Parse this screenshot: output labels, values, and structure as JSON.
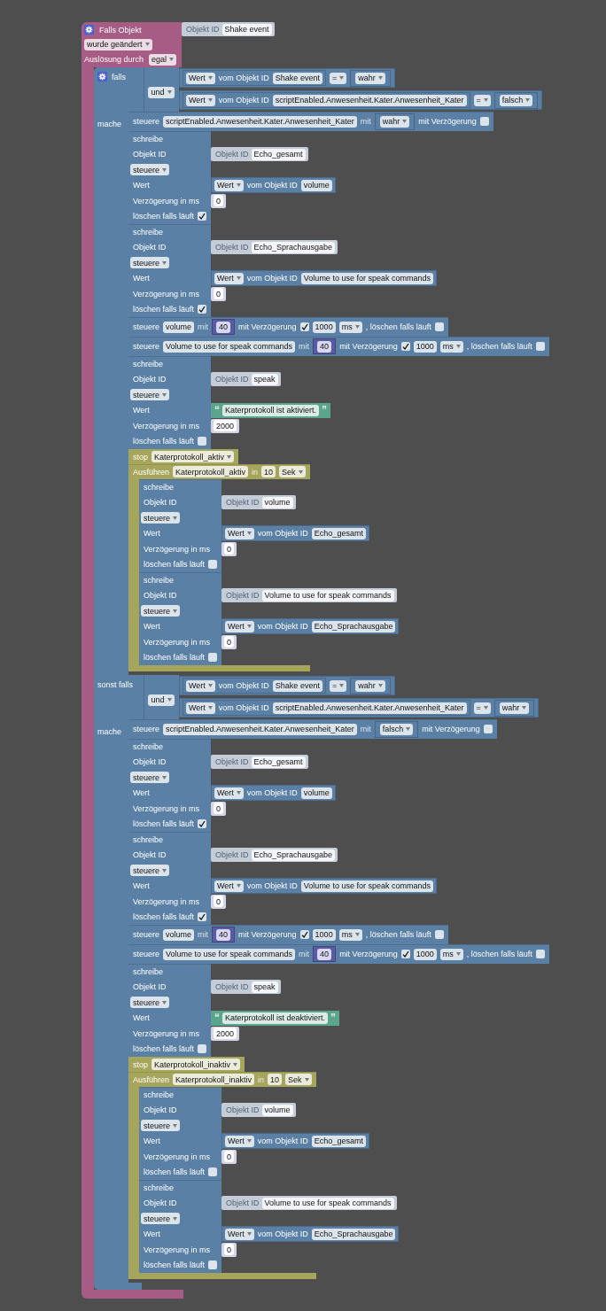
{
  "trigger": {
    "title": "Falls Objekt",
    "object": {
      "label": "Objekt ID",
      "id": "Shake event"
    },
    "event": "wurde geändert",
    "source_label": "Auslösung durch",
    "source": "egal"
  },
  "if_block": {
    "branches": [
      {
        "label": "falls",
        "operator": "und",
        "conditions": [
          {
            "mode": "Wert",
            "from_label": "vom Objekt ID",
            "id": "Shake event",
            "comparator": "=",
            "operand": "wahr"
          },
          {
            "mode": "Wert",
            "from_label": "vom Objekt ID",
            "id": "scriptEnabled.Anwesenheit.Kater.Anwesenheit_Kater",
            "comparator": "=",
            "operand": "falsch"
          }
        ],
        "do_label": "mache",
        "statements": [
          {
            "kind": "control",
            "label": "steuere",
            "id": "scriptEnabled.Anwesenheit.Kater.Anwesenheit_Kater",
            "with_label": "mit",
            "value": {
              "kind": "boolean",
              "text": "wahr"
            },
            "delay_label": "mit Verzögerung",
            "delay": false
          },
          {
            "kind": "write",
            "title": "schreibe",
            "id_label": "Objekt ID",
            "object": {
              "label": "Objekt ID",
              "id": "Echo_gesamt"
            },
            "action": "steuere",
            "value_label": "Wert",
            "value": {
              "kind": "get",
              "mode": "Wert",
              "from_label": "vom Objekt ID",
              "id": "volume"
            },
            "delay_label": "Verzögerung in ms",
            "delay_ms": "0",
            "clear_label": "löschen falls läuft",
            "clear": true
          },
          {
            "kind": "write",
            "title": "schreibe",
            "id_label": "Objekt ID",
            "object": {
              "label": "Objekt ID",
              "id": "Echo_Sprachausgabe"
            },
            "action": "steuere",
            "value_label": "Wert",
            "value": {
              "kind": "get",
              "mode": "Wert",
              "from_label": "vom Objekt ID",
              "id": "Volume to use for speak commands"
            },
            "delay_label": "Verzögerung in ms",
            "delay_ms": "0",
            "clear_label": "löschen falls läuft",
            "clear": true
          },
          {
            "kind": "control",
            "label": "steuere",
            "id": "volume",
            "with_label": "mit",
            "value": {
              "kind": "number",
              "text": "40"
            },
            "delay_label": "mit Verzögerung",
            "delay": true,
            "delay_ms": "1000",
            "unit": "ms",
            "clear_label": ", löschen falls läuft",
            "clear": false
          },
          {
            "kind": "control",
            "label": "steuere",
            "id": "Volume to use for speak commands",
            "with_label": "mit",
            "value": {
              "kind": "number",
              "text": "40"
            },
            "delay_label": "mit Verzögerung",
            "delay": true,
            "delay_ms": "1000",
            "unit": "ms",
            "clear_label": ", löschen falls läuft",
            "clear": false
          },
          {
            "kind": "write",
            "title": "schreibe",
            "id_label": "Objekt ID",
            "object": {
              "label": "Objekt ID",
              "id": "speak"
            },
            "action": "steuere",
            "value_label": "Wert",
            "value": {
              "kind": "text",
              "open": "“",
              "text": "Katerprotokoll ist aktiviert.",
              "close": "”"
            },
            "delay_label": "Verzögerung in ms",
            "delay_ms": "2000",
            "clear_label": "löschen falls läuft",
            "clear": false
          },
          {
            "kind": "stop",
            "label": "stop",
            "timer": "Katerprotokoll_aktiv"
          },
          {
            "kind": "timeout",
            "label": "Ausführen",
            "timer": "Katerprotokoll_aktiv",
            "in_label": "in",
            "interval": "10",
            "unit": "Sek",
            "statements": [
              {
                "kind": "write",
                "title": "schreibe",
                "id_label": "Objekt ID",
                "object": {
                  "label": "Objekt ID",
                  "id": "volume"
                },
                "action": "steuere",
                "value_label": "Wert",
                "value": {
                  "kind": "get",
                  "mode": "Wert",
                  "from_label": "vom Objekt ID",
                  "id": "Echo_gesamt"
                },
                "delay_label": "Verzögerung in ms",
                "delay_ms": "0",
                "clear_label": "löschen falls läuft",
                "clear": false
              },
              {
                "kind": "write",
                "title": "schreibe",
                "id_label": "Objekt ID",
                "object": {
                  "label": "Objekt ID",
                  "id": "Volume to use for speak commands"
                },
                "action": "steuere",
                "value_label": "Wert",
                "value": {
                  "kind": "get",
                  "mode": "Wert",
                  "from_label": "vom Objekt ID",
                  "id": "Echo_Sprachausgabe"
                },
                "delay_label": "Verzögerung in ms",
                "delay_ms": "0",
                "clear_label": "löschen falls läuft",
                "clear": false
              }
            ]
          }
        ]
      },
      {
        "label": "sonst falls",
        "operator": "und",
        "conditions": [
          {
            "mode": "Wert",
            "from_label": "vom Objekt ID",
            "id": "Shake event",
            "comparator": "=",
            "operand": "wahr"
          },
          {
            "mode": "Wert",
            "from_label": "vom Objekt ID",
            "id": "scriptEnabled.Anwesenheit.Kater.Anwesenheit_Kater",
            "comparator": "=",
            "operand": "wahr"
          }
        ],
        "do_label": "mache",
        "statements": [
          {
            "kind": "control",
            "label": "steuere",
            "id": "scriptEnabled.Anwesenheit.Kater.Anwesenheit_Kater",
            "with_label": "mit",
            "value": {
              "kind": "boolean",
              "text": "falsch"
            },
            "delay_label": "mit Verzögerung",
            "delay": false
          },
          {
            "kind": "write",
            "title": "schreibe",
            "id_label": "Objekt ID",
            "object": {
              "label": "Objekt ID",
              "id": "Echo_gesamt"
            },
            "action": "steuere",
            "value_label": "Wert",
            "value": {
              "kind": "get",
              "mode": "Wert",
              "from_label": "vom Objekt ID",
              "id": "volume"
            },
            "delay_label": "Verzögerung in ms",
            "delay_ms": "0",
            "clear_label": "löschen falls läuft",
            "clear": true
          },
          {
            "kind": "write",
            "title": "schreibe",
            "id_label": "Objekt ID",
            "object": {
              "label": "Objekt ID",
              "id": "Echo_Sprachausgabe"
            },
            "action": "steuere",
            "value_label": "Wert",
            "value": {
              "kind": "get",
              "mode": "Wert",
              "from_label": "vom Objekt ID",
              "id": "Volume to use for speak commands"
            },
            "delay_label": "Verzögerung in ms",
            "delay_ms": "0",
            "clear_label": "löschen falls läuft",
            "clear": true
          },
          {
            "kind": "control",
            "label": "steuere",
            "id": "volume",
            "with_label": "mit",
            "value": {
              "kind": "number",
              "text": "40"
            },
            "delay_label": "mit Verzögerung",
            "delay": true,
            "delay_ms": "1000",
            "unit": "ms",
            "clear_label": ", löschen falls läuft",
            "clear": false
          },
          {
            "kind": "control",
            "label": "steuere",
            "id": "Volume to use for speak commands",
            "with_label": "mit",
            "value": {
              "kind": "number",
              "text": "40"
            },
            "delay_label": "mit Verzögerung",
            "delay": true,
            "delay_ms": "1000",
            "unit": "ms",
            "clear_label": ", löschen falls läuft",
            "clear": false
          },
          {
            "kind": "write",
            "title": "schreibe",
            "id_label": "Objekt ID",
            "object": {
              "label": "Objekt ID",
              "id": "speak"
            },
            "action": "steuere",
            "value_label": "Wert",
            "value": {
              "kind": "text",
              "open": "“",
              "text": "Katerprotokoll ist deaktiviert.",
              "close": "”"
            },
            "delay_label": "Verzögerung in ms",
            "delay_ms": "2000",
            "clear_label": "löschen falls läuft",
            "clear": false
          },
          {
            "kind": "stop",
            "label": "stop",
            "timer": "Katerprotokoll_inaktiv"
          },
          {
            "kind": "timeout",
            "label": "Ausführen",
            "timer": "Katerprotokoll_inaktiv",
            "in_label": "in",
            "interval": "10",
            "unit": "Sek",
            "statements": [
              {
                "kind": "write",
                "title": "schreibe",
                "id_label": "Objekt ID",
                "object": {
                  "label": "Objekt ID",
                  "id": "volume"
                },
                "action": "steuere",
                "value_label": "Wert",
                "value": {
                  "kind": "get",
                  "mode": "Wert",
                  "from_label": "vom Objekt ID",
                  "id": "Echo_gesamt"
                },
                "delay_label": "Verzögerung in ms",
                "delay_ms": "0",
                "clear_label": "löschen falls läuft",
                "clear": false
              },
              {
                "kind": "write",
                "title": "schreibe",
                "id_label": "Objekt ID",
                "object": {
                  "label": "Objekt ID",
                  "id": "Volume to use for speak commands"
                },
                "action": "steuere",
                "value_label": "Wert",
                "value": {
                  "kind": "get",
                  "mode": "Wert",
                  "from_label": "vom Objekt ID",
                  "id": "Echo_Sprachausgabe"
                },
                "delay_label": "Verzögerung in ms",
                "delay_ms": "0",
                "clear_label": "löschen falls läuft",
                "clear": false
              }
            ]
          }
        ]
      }
    ]
  }
}
